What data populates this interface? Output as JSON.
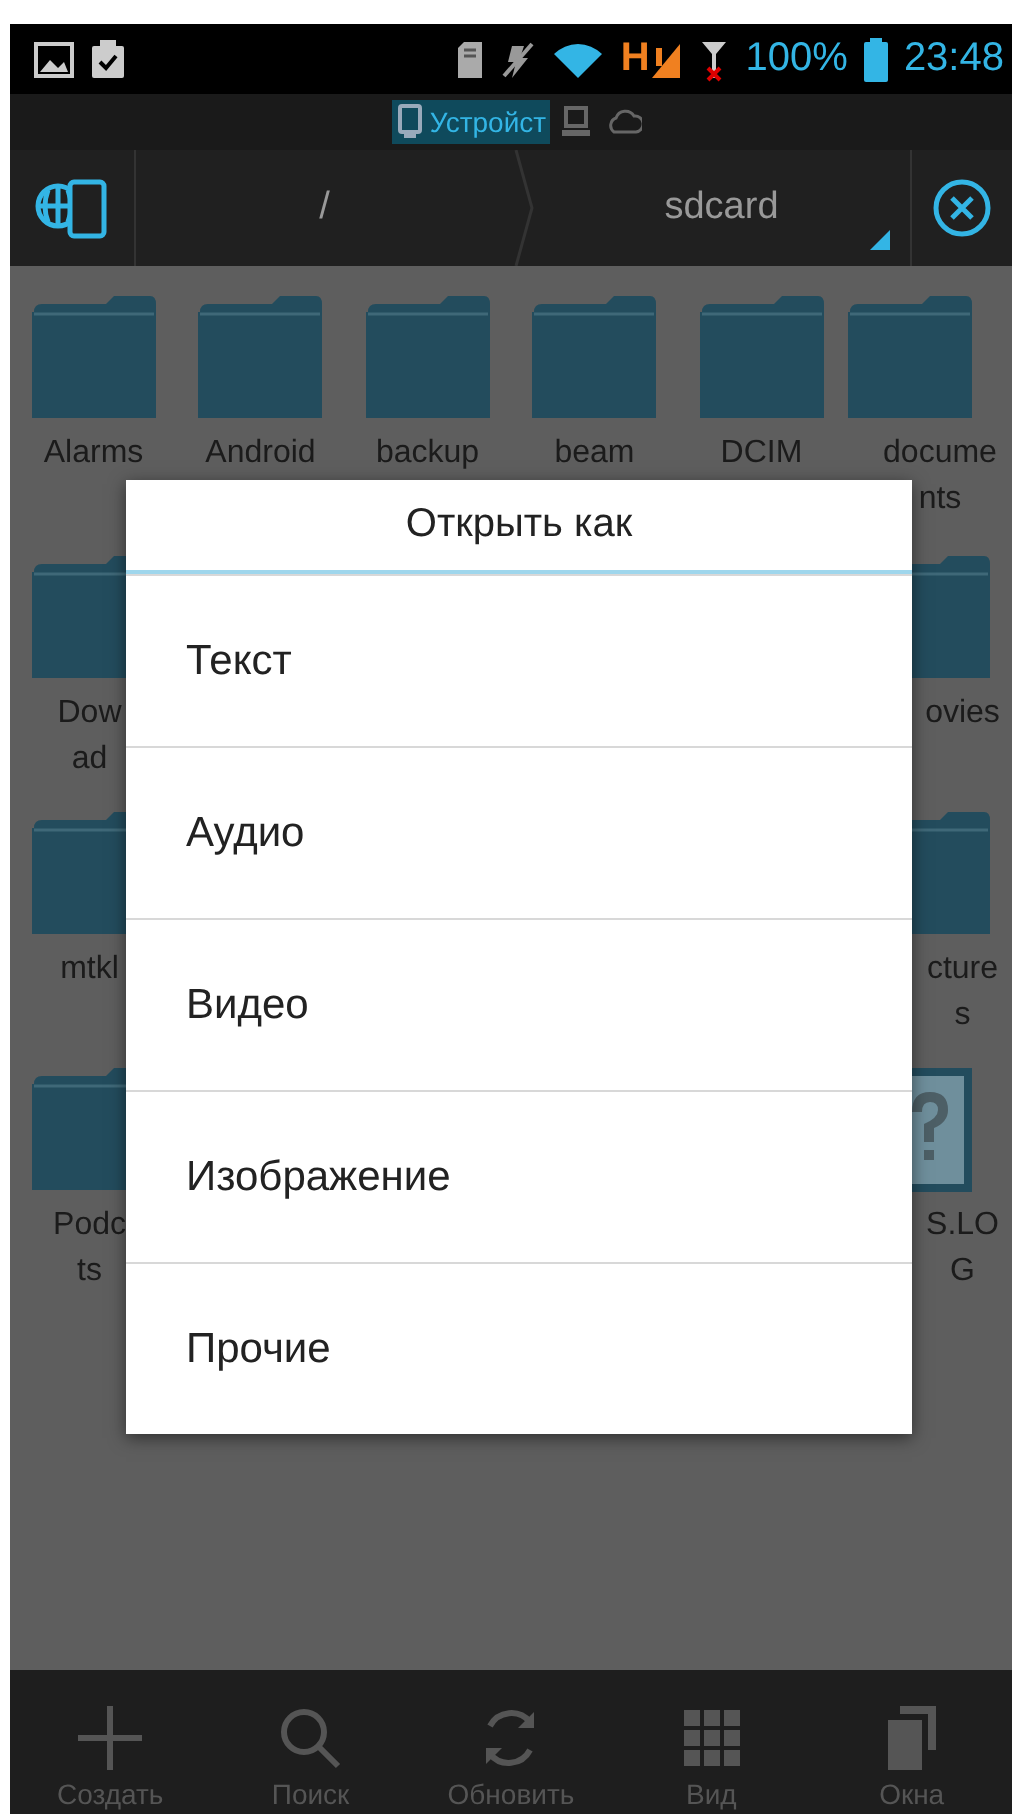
{
  "status_bar": {
    "network": "H",
    "battery": "100%",
    "time": "23:48"
  },
  "location_tabs": [
    {
      "kind": "device",
      "label": "Устройст",
      "selected": true
    },
    {
      "kind": "computer",
      "selected": false
    },
    {
      "kind": "cloud",
      "selected": false
    }
  ],
  "path_bar": {
    "segments": [
      "/",
      "sdcard"
    ]
  },
  "files": {
    "top_row": [
      {
        "kind": "folder",
        "name": "Alarms"
      },
      {
        "kind": "folder",
        "name": "Android"
      },
      {
        "kind": "folder",
        "name": "backup"
      },
      {
        "kind": "folder",
        "name": "beam"
      },
      {
        "kind": "folder",
        "name": "DCIM"
      },
      {
        "kind": "folder",
        "name": "docume nts"
      }
    ],
    "left_column": [
      {
        "kind": "folder",
        "name": "Dow ad"
      },
      {
        "kind": "folder",
        "name": "mtkl"
      },
      {
        "kind": "folder",
        "name": "Podc ts"
      }
    ],
    "right_column": [
      {
        "kind": "folder",
        "name": "ovies"
      },
      {
        "kind": "folder",
        "name": "cture s"
      },
      {
        "kind": "unknown",
        "name": "S.LO G"
      }
    ]
  },
  "dialog": {
    "title": "Открыть как",
    "options": [
      "Текст",
      "Аудио",
      "Видео",
      "Изображение",
      "Прочие"
    ]
  },
  "bottom_bar": [
    {
      "kind": "create",
      "label": "Создать"
    },
    {
      "kind": "search",
      "label": "Поиск"
    },
    {
      "kind": "refresh",
      "label": "Обновить"
    },
    {
      "kind": "view",
      "label": "Вид"
    },
    {
      "kind": "windows",
      "label": "Окна"
    }
  ]
}
